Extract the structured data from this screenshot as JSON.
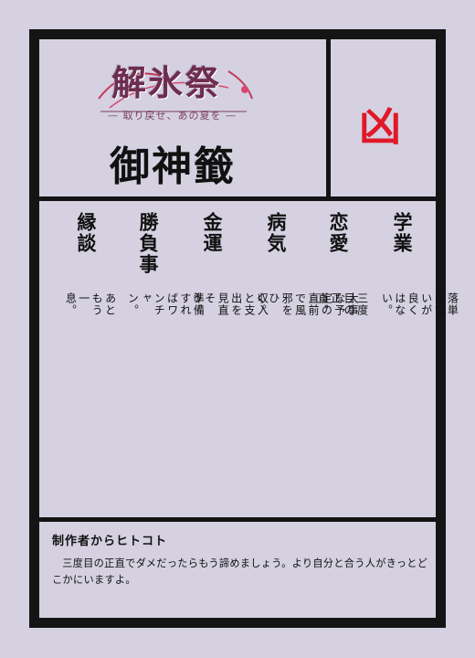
{
  "logo": {
    "title": "解氷祭",
    "subtitle": "— 取り戻せ、あの夏を —"
  },
  "page_title": "御神籤",
  "fortune": "凶",
  "columns": [
    {
      "id": "study",
      "heading": "学業",
      "text": "落単はないが良くはない。"
    },
    {
      "id": "love",
      "heading": "恋愛",
      "text": "三度目の正直。"
    },
    {
      "id": "illness",
      "heading": "病気",
      "text": "大事な予定の直前で風邪をひく。"
    },
    {
      "id": "money",
      "heading": "金運",
      "text": "収入と支出を見直そう。"
    },
    {
      "id": "contest",
      "heading": "勝負事",
      "text": "準備すればワンチャン。"
    },
    {
      "id": "marriage",
      "heading": "縁談",
      "text": "あともう一息。"
    }
  ],
  "comment": {
    "title": "制作者からヒトコト",
    "text": "三度目の正直でダメだったらもう諦めましょう。より自分と合う人がきっとどこかにいますよ。"
  },
  "colors": {
    "background": "#d5d1e1",
    "frame": "#141414",
    "fortune_red": "#e0192a",
    "logo": "#6e2d4e"
  }
}
